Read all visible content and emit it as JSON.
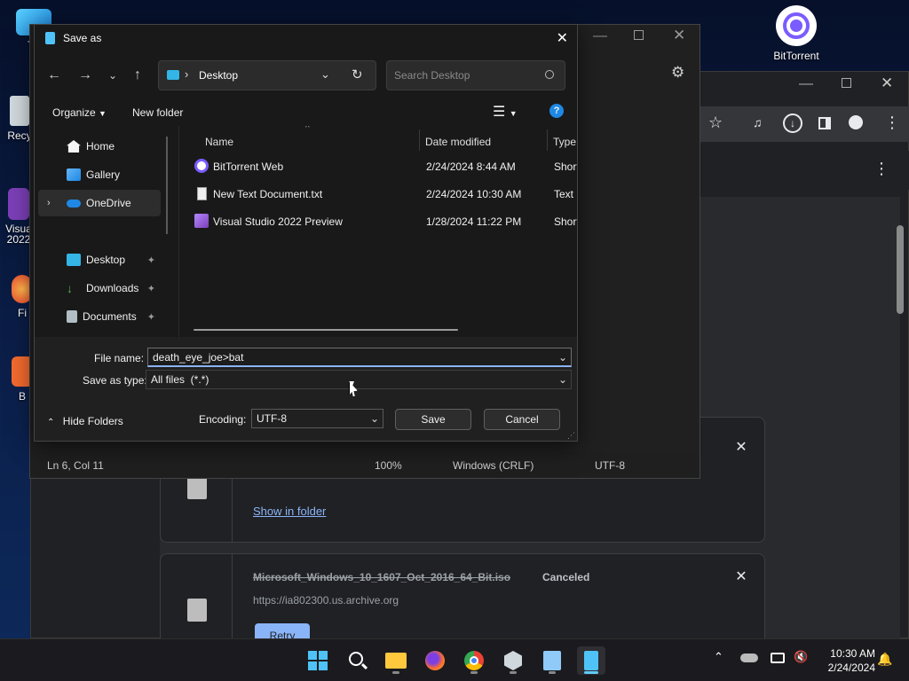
{
  "desktop": {
    "icons": [
      {
        "label": "Th"
      },
      {
        "label": "Recy"
      },
      {
        "label": "Visua\n2022"
      },
      {
        "label": "Fi"
      },
      {
        "label": "B"
      }
    ],
    "bittorrent_label": "BitTorrent"
  },
  "notepad": {
    "status_position": "Ln 6, Col 11",
    "status_zoom": "100%",
    "status_eol": "Windows (CRLF)",
    "status_encoding": "UTF-8"
  },
  "downloads": {
    "show_in_folder": "Show in folder",
    "item2_name": "Microsoft_Windows_10_1607_Oct_2016_64_Bit.iso",
    "item2_status": "Canceled",
    "item2_url": "https://ia802300.us.archive.org",
    "retry_label": "Retry"
  },
  "dialog": {
    "title": "Save as",
    "breadcrumb_location": "Desktop",
    "search_placeholder": "Search Desktop",
    "organize_label": "Organize",
    "new_folder_label": "New folder",
    "nav_items": [
      {
        "label": "Home"
      },
      {
        "label": "Gallery"
      },
      {
        "label": "OneDrive"
      },
      {
        "label": "Desktop"
      },
      {
        "label": "Downloads"
      },
      {
        "label": "Documents"
      }
    ],
    "columns": {
      "name": "Name",
      "date": "Date modified",
      "type": "Type"
    },
    "files": [
      {
        "name": "BitTorrent Web",
        "date": "2/24/2024 8:44 AM",
        "type": "Short"
      },
      {
        "name": "New Text Document.txt",
        "date": "2/24/2024 10:30 AM",
        "type": "Text D"
      },
      {
        "name": "Visual Studio 2022 Preview",
        "date": "1/28/2024 11:22 PM",
        "type": "Short"
      }
    ],
    "file_name_label": "File name:",
    "file_name_value": "death_eye_joe>bat",
    "save_as_type_label": "Save as type:",
    "save_as_type_value": "All files  (*.*)",
    "hide_folders_label": "Hide Folders",
    "encoding_label": "Encoding:",
    "encoding_value": "UTF-8",
    "save_label": "Save",
    "cancel_label": "Cancel"
  },
  "taskbar": {
    "time": "10:30 AM",
    "date": "2/24/2024"
  },
  "colors": {
    "accent": "#60cdff",
    "link": "#8ab4f8",
    "dialog_bg": "#191919"
  }
}
